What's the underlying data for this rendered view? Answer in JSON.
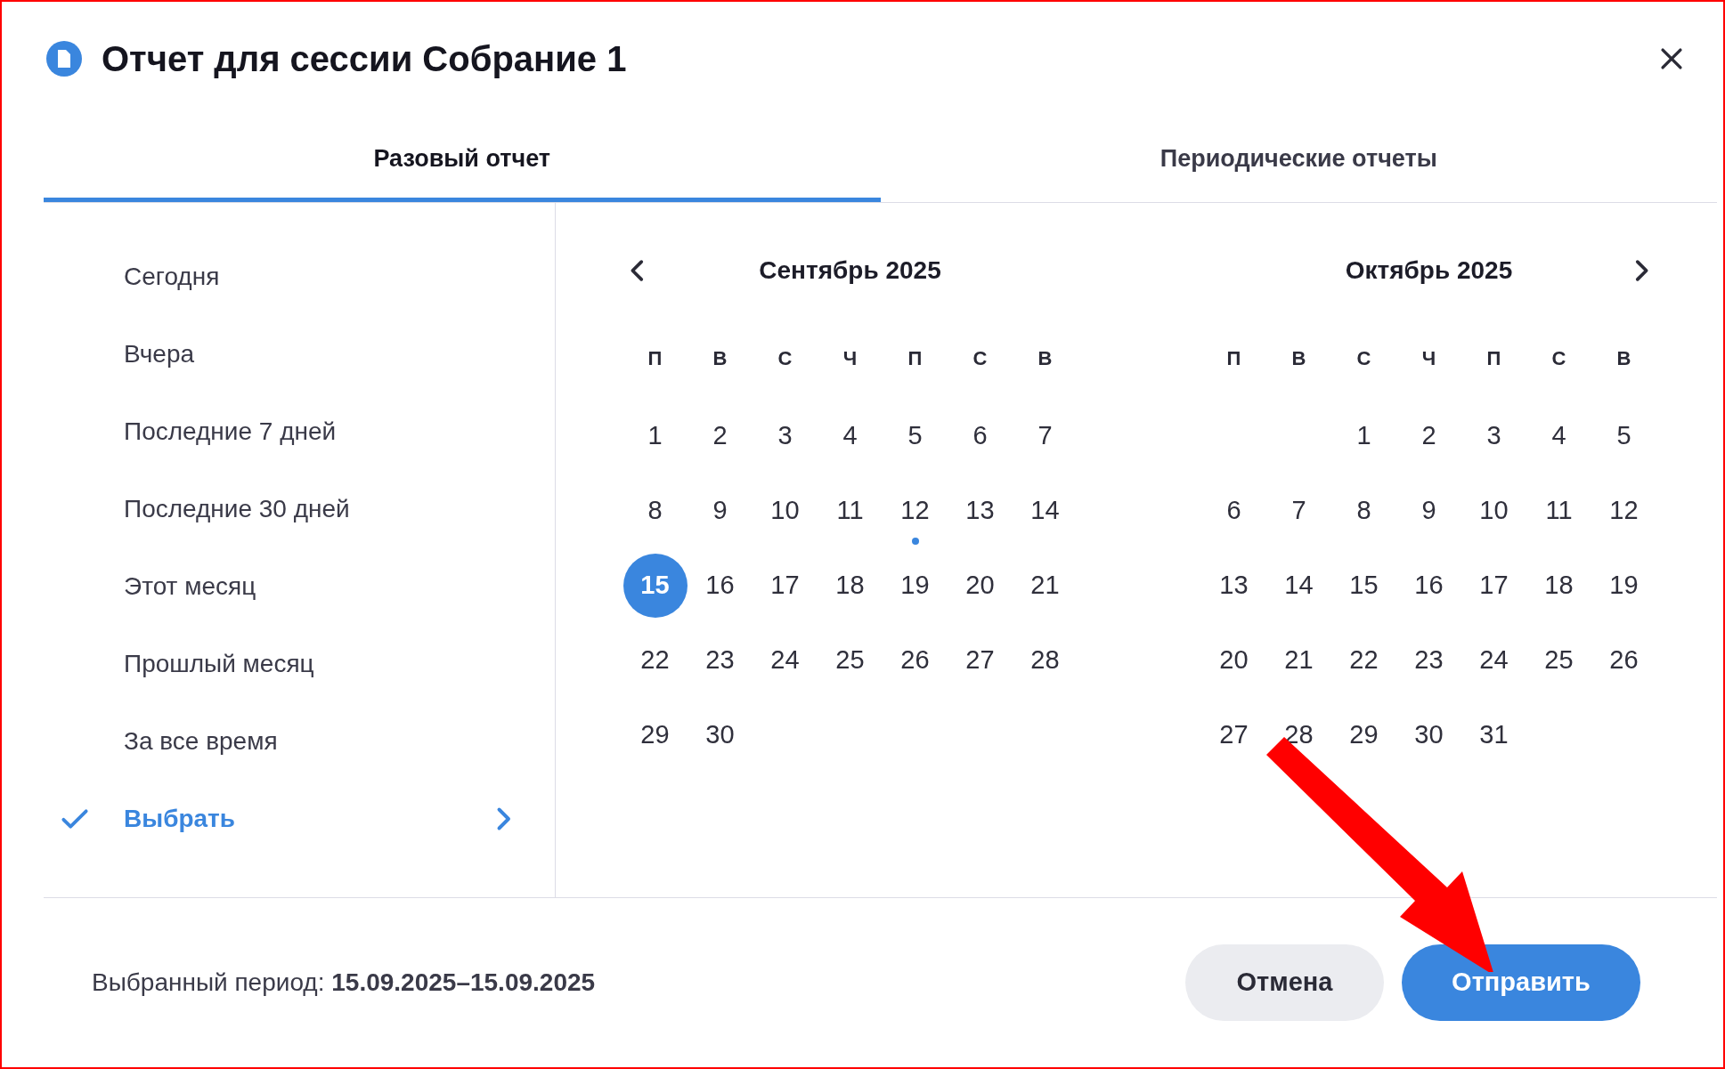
{
  "dialog": {
    "title": "Отчет для сессии Собрание 1"
  },
  "tabs": [
    {
      "label": "Разовый отчет",
      "selected": true
    },
    {
      "label": "Периодические отчеты",
      "selected": false
    }
  ],
  "presets": [
    {
      "label": "Сегодня",
      "selected": false,
      "kind": "preset"
    },
    {
      "label": "Вчера",
      "selected": false,
      "kind": "preset"
    },
    {
      "label": "Последние 7 дней",
      "selected": false,
      "kind": "preset"
    },
    {
      "label": "Последние 30 дней",
      "selected": false,
      "kind": "preset"
    },
    {
      "label": "Этот месяц",
      "selected": false,
      "kind": "preset"
    },
    {
      "label": "Прошлый месяц",
      "selected": false,
      "kind": "preset"
    },
    {
      "label": "За все время",
      "selected": false,
      "kind": "preset"
    },
    {
      "label": "Выбрать",
      "selected": true,
      "kind": "submenu"
    }
  ],
  "months": [
    {
      "title": "Сентябрь 2025",
      "weekdays": [
        "П",
        "В",
        "С",
        "Ч",
        "П",
        "С",
        "В"
      ],
      "weeks": [
        {
          "kind": "normal",
          "days": [
            {
              "label": "1",
              "selected": false,
              "today": false
            },
            {
              "label": "2",
              "selected": false,
              "today": false
            },
            {
              "label": "3",
              "selected": false,
              "today": false
            },
            {
              "label": "4",
              "selected": false,
              "today": false
            },
            {
              "label": "5",
              "selected": false,
              "today": false
            },
            {
              "label": "6",
              "selected": false,
              "today": false
            },
            {
              "label": "7",
              "selected": false,
              "today": false
            }
          ]
        },
        {
          "kind": "normal",
          "days": [
            {
              "label": "8",
              "selected": false,
              "today": false
            },
            {
              "label": "9",
              "selected": false,
              "today": false
            },
            {
              "label": "10",
              "selected": false,
              "today": false
            },
            {
              "label": "11",
              "selected": false,
              "today": false
            },
            {
              "label": "12",
              "selected": false,
              "today": true
            },
            {
              "label": "13",
              "selected": false,
              "today": false
            },
            {
              "label": "14",
              "selected": false,
              "today": false
            }
          ]
        },
        {
          "kind": "normal",
          "days": [
            {
              "label": "15",
              "selected": true,
              "today": false
            },
            {
              "label": "16",
              "selected": false,
              "today": false
            },
            {
              "label": "17",
              "selected": false,
              "today": false
            },
            {
              "label": "18",
              "selected": false,
              "today": false
            },
            {
              "label": "19",
              "selected": false,
              "today": false
            },
            {
              "label": "20",
              "selected": false,
              "today": false
            },
            {
              "label": "21",
              "selected": false,
              "today": false
            }
          ]
        },
        {
          "kind": "normal",
          "days": [
            {
              "label": "22",
              "selected": false,
              "today": false
            },
            {
              "label": "23",
              "selected": false,
              "today": false
            },
            {
              "label": "24",
              "selected": false,
              "today": false
            },
            {
              "label": "25",
              "selected": false,
              "today": false
            },
            {
              "label": "26",
              "selected": false,
              "today": false
            },
            {
              "label": "27",
              "selected": false,
              "today": false
            },
            {
              "label": "28",
              "selected": false,
              "today": false
            }
          ]
        },
        {
          "kind": "normal",
          "days": [
            {
              "label": "29",
              "selected": false,
              "today": false
            },
            {
              "label": "30",
              "selected": false,
              "today": false
            }
          ]
        }
      ]
    },
    {
      "title": "Октябрь 2025",
      "weekdays": [
        "П",
        "В",
        "С",
        "Ч",
        "П",
        "С",
        "В"
      ],
      "weeks": [
        {
          "kind": "leading",
          "days": [
            {
              "label": "1",
              "selected": false,
              "today": false
            },
            {
              "label": "2",
              "selected": false,
              "today": false
            },
            {
              "label": "3",
              "selected": false,
              "today": false
            },
            {
              "label": "4",
              "selected": false,
              "today": false
            },
            {
              "label": "5",
              "selected": false,
              "today": false
            }
          ]
        },
        {
          "kind": "normal",
          "days": [
            {
              "label": "6",
              "selected": false,
              "today": false
            },
            {
              "label": "7",
              "selected": false,
              "today": false
            },
            {
              "label": "8",
              "selected": false,
              "today": false
            },
            {
              "label": "9",
              "selected": false,
              "today": false
            },
            {
              "label": "10",
              "selected": false,
              "today": false
            },
            {
              "label": "11",
              "selected": false,
              "today": false
            },
            {
              "label": "12",
              "selected": false,
              "today": false
            }
          ]
        },
        {
          "kind": "normal",
          "days": [
            {
              "label": "13",
              "selected": false,
              "today": false
            },
            {
              "label": "14",
              "selected": false,
              "today": false
            },
            {
              "label": "15",
              "selected": false,
              "today": false
            },
            {
              "label": "16",
              "selected": false,
              "today": false
            },
            {
              "label": "17",
              "selected": false,
              "today": false
            },
            {
              "label": "18",
              "selected": false,
              "today": false
            },
            {
              "label": "19",
              "selected": false,
              "today": false
            }
          ]
        },
        {
          "kind": "normal",
          "days": [
            {
              "label": "20",
              "selected": false,
              "today": false
            },
            {
              "label": "21",
              "selected": false,
              "today": false
            },
            {
              "label": "22",
              "selected": false,
              "today": false
            },
            {
              "label": "23",
              "selected": false,
              "today": false
            },
            {
              "label": "24",
              "selected": false,
              "today": false
            },
            {
              "label": "25",
              "selected": false,
              "today": false
            },
            {
              "label": "26",
              "selected": false,
              "today": false
            }
          ]
        },
        {
          "kind": "normal",
          "days": [
            {
              "label": "27",
              "selected": false,
              "today": false
            },
            {
              "label": "28",
              "selected": false,
              "today": false
            },
            {
              "label": "29",
              "selected": false,
              "today": false
            },
            {
              "label": "30",
              "selected": false,
              "today": false
            },
            {
              "label": "31",
              "selected": false,
              "today": false
            }
          ]
        }
      ]
    }
  ],
  "footer": {
    "period": "Выбранный период: **15.09.2025–15.09.2025**",
    "buttons": [
      {
        "label": "Отмена",
        "kind": "secondary"
      },
      {
        "label": "Отправить",
        "kind": "primary"
      }
    ]
  }
}
